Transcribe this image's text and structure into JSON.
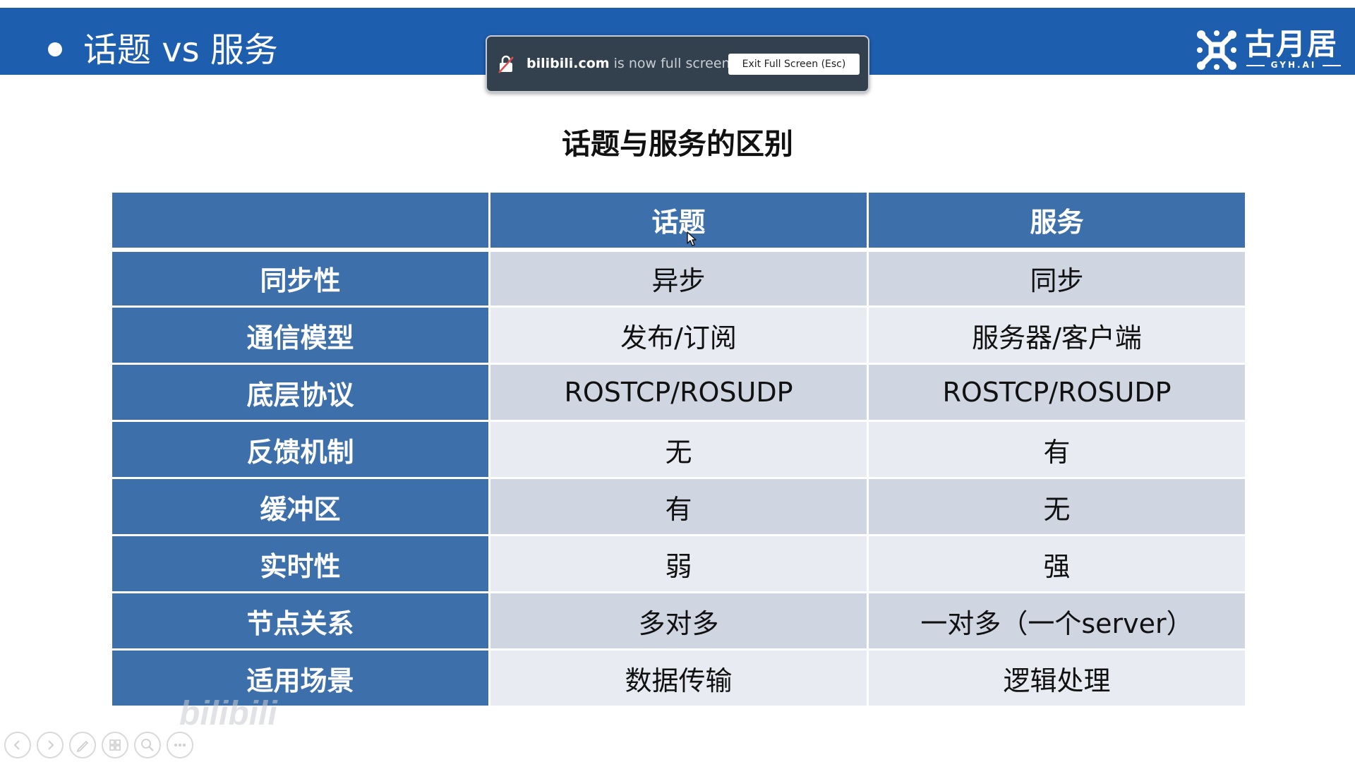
{
  "slide_header": {
    "title": "话题 vs 服务",
    "logo_text": "古月居",
    "logo_sub": "GYH.AI"
  },
  "fullscreen_notice": {
    "site": "bilibili.com",
    "message": " is now full screen",
    "exit_label": "Exit Full Screen (Esc)"
  },
  "table_title": "话题与服务的区别",
  "comparison": {
    "columns": [
      "",
      "话题",
      "服务"
    ],
    "rows": [
      {
        "aspect": "同步性",
        "topic": "异步",
        "service": "同步"
      },
      {
        "aspect": "通信模型",
        "topic": "发布/订阅",
        "service": "服务器/客户端"
      },
      {
        "aspect": "底层协议",
        "topic": "ROSTCP/ROSUDP",
        "service": "ROSTCP/ROSUDP"
      },
      {
        "aspect": "反馈机制",
        "topic": "无",
        "service": "有"
      },
      {
        "aspect": "缓冲区",
        "topic": "有",
        "service": "无"
      },
      {
        "aspect": "实时性",
        "topic": "弱",
        "service": "强"
      },
      {
        "aspect": "节点关系",
        "topic": "多对多",
        "service": "一对多（一个server）"
      },
      {
        "aspect": "适用场景",
        "topic": "数据传输",
        "service": "逻辑处理"
      }
    ]
  },
  "watermark_text": "bilibili",
  "toolbar": [
    "previous-icon",
    "next-icon",
    "pen-icon",
    "slides-icon",
    "zoom-icon",
    "more-icon"
  ],
  "colors": {
    "header_bar": "#1e5eae",
    "table_header": "#3d6fab",
    "row_light": "#e8ebf1",
    "row_dark": "#cfd6e2",
    "notice_bg": "#33414f"
  }
}
